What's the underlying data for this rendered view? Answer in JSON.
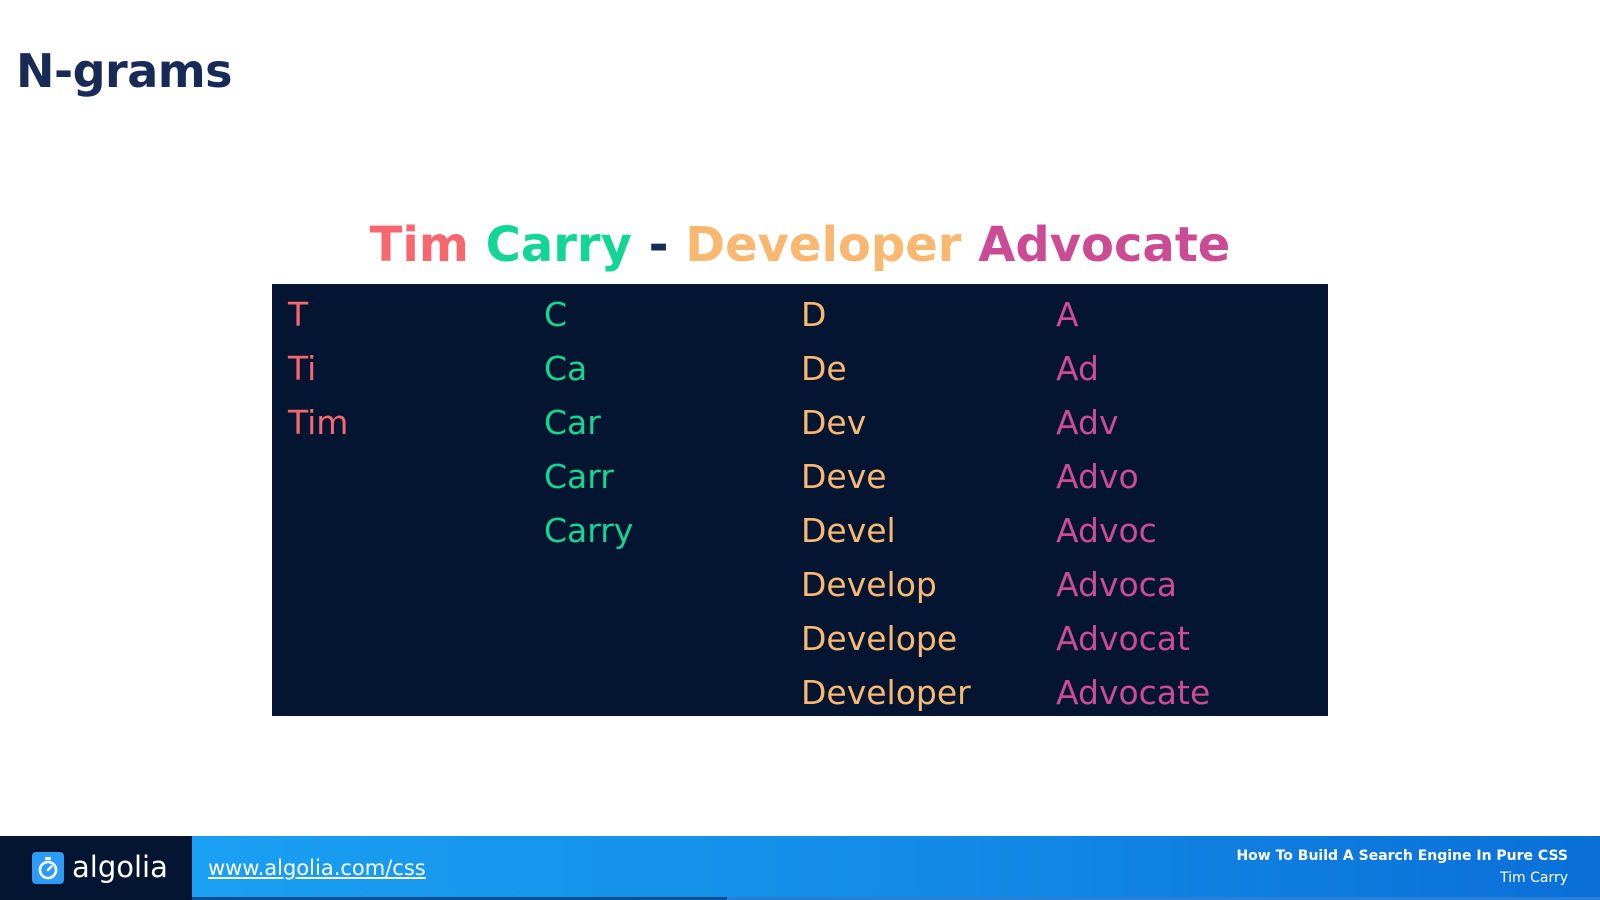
{
  "slide": {
    "title": "N-grams"
  },
  "headline": {
    "parts": [
      {
        "text": "Tim",
        "color": "#f7676f"
      },
      {
        "text": "Carry",
        "color": "#13d594"
      },
      {
        "text": "-",
        "color": "#182a56"
      },
      {
        "text": "Developer",
        "color": "#f8b871"
      },
      {
        "text": "Advocate",
        "color": "#cc4b95"
      }
    ]
  },
  "ngrams": {
    "columns": [
      {
        "word": "Tim",
        "color": "#f7676f",
        "items": [
          "T",
          "Ti",
          "Tim"
        ]
      },
      {
        "word": "Carry",
        "color": "#13d594",
        "items": [
          "C",
          "Ca",
          "Car",
          "Carr",
          "Carry"
        ]
      },
      {
        "word": "Developer",
        "color": "#f8b871",
        "items": [
          "D",
          "De",
          "Dev",
          "Deve",
          "Devel",
          "Develop",
          "Develope",
          "Developer"
        ]
      },
      {
        "word": "Advocate",
        "color": "#cc4b95",
        "items": [
          "A",
          "Ad",
          "Adv",
          "Advo",
          "Advoc",
          "Advoca",
          "Advocat",
          "Advocate"
        ]
      }
    ]
  },
  "footer": {
    "logo_text": "algolia",
    "logo_icon": "algolia-stopwatch-icon",
    "link": "www.algolia.com/css",
    "talk_title": "How To Build A Search Engine In Pure CSS",
    "author": "Tim Carry"
  },
  "colors": {
    "title": "#182a56",
    "panel_bg": "#031530",
    "footer_dark": "#031530",
    "footer_blue": "#1aa0f2"
  }
}
